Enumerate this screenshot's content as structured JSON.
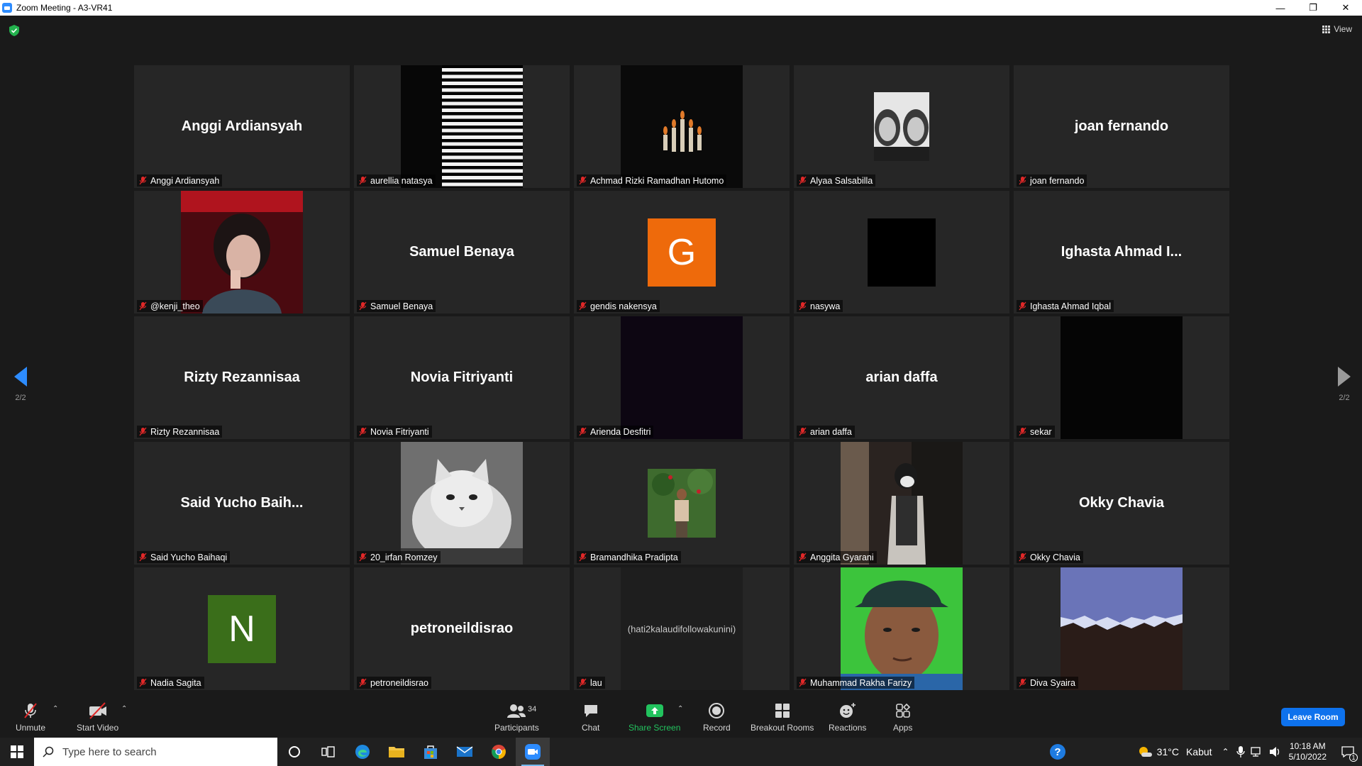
{
  "window": {
    "title": "Zoom Meeting - A3-VR41",
    "minimize": "—",
    "restore": "❐",
    "close": "✕"
  },
  "meeting": {
    "view_label": "View",
    "page_indicator_left": "2/2",
    "page_indicator_right": "2/2"
  },
  "tiles": [
    {
      "display": "Anggi Ardiansyah",
      "label": "Anggi Ardiansyah",
      "kind": "name"
    },
    {
      "label": "aurellia natasya",
      "kind": "blinds"
    },
    {
      "label": "Achmad Rizki Ramadhan Hutomo",
      "kind": "candles"
    },
    {
      "label": "Alyaa Salsabilla",
      "kind": "twins"
    },
    {
      "display": "joan fernando",
      "label": "joan fernando",
      "kind": "name"
    },
    {
      "label": "@kenji_theo",
      "kind": "redroom"
    },
    {
      "display": "Samuel Benaya",
      "label": "Samuel Benaya",
      "kind": "name"
    },
    {
      "label": "gendis nakensya",
      "kind": "letter",
      "letter": "G",
      "color": "#ee6a0b"
    },
    {
      "label": "nasywa",
      "kind": "blacksquare"
    },
    {
      "display": "Ighasta Ahmad I...",
      "label": "Ighasta Ahmad Iqbal",
      "kind": "name"
    },
    {
      "display": "Rizty Rezannisaa",
      "label": "Rizty Rezannisaa",
      "kind": "name"
    },
    {
      "display": "Novia Fitriyanti",
      "label": "Novia Fitriyanti",
      "kind": "name"
    },
    {
      "label": "Arienda Desfitri",
      "kind": "darkvideo"
    },
    {
      "display": "arian daffa",
      "label": "arian daffa",
      "kind": "name"
    },
    {
      "label": "sekar",
      "kind": "blackvideo"
    },
    {
      "display": "Said Yucho Baih...",
      "label": "Said Yucho Baihaqi",
      "kind": "name"
    },
    {
      "label": "20_irfan Romzey",
      "kind": "cat"
    },
    {
      "label": "Bramandhika Pradipta",
      "kind": "garden"
    },
    {
      "label": "Anggita Gyarani",
      "kind": "mirror"
    },
    {
      "display": "Okky Chavia",
      "label": "Okky Chavia",
      "kind": "name"
    },
    {
      "label": "Nadia Sagita",
      "kind": "letter",
      "letter": "N",
      "color": "#3a6e1a"
    },
    {
      "display": "petroneildisrao",
      "label": "petroneildisrao",
      "kind": "name"
    },
    {
      "label": "lau",
      "kind": "textvideo",
      "video_text": "(hati2kalaudifollowakunini)"
    },
    {
      "label": "Muhammad Rakha Farizy",
      "kind": "face"
    },
    {
      "label": "Diva Syaira",
      "kind": "paper"
    }
  ],
  "toolbar": {
    "unmute": "Unmute",
    "start_video": "Start Video",
    "participants": "Participants",
    "participant_count": "34",
    "chat": "Chat",
    "share_screen": "Share Screen",
    "record": "Record",
    "breakout_rooms": "Breakout Rooms",
    "reactions": "Reactions",
    "apps": "Apps",
    "leave_room": "Leave Room"
  },
  "taskbar": {
    "search_placeholder": "Type here to search",
    "weather_temp": "31°C",
    "weather_desc": "Kabut",
    "time": "10:18 AM",
    "date": "5/10/2022",
    "notification_count": "1"
  },
  "colors": {
    "zoom_blue": "#0e72ed",
    "share_green": "#22c35e",
    "muted_red": "#e02828",
    "tile_bg": "#262626"
  }
}
